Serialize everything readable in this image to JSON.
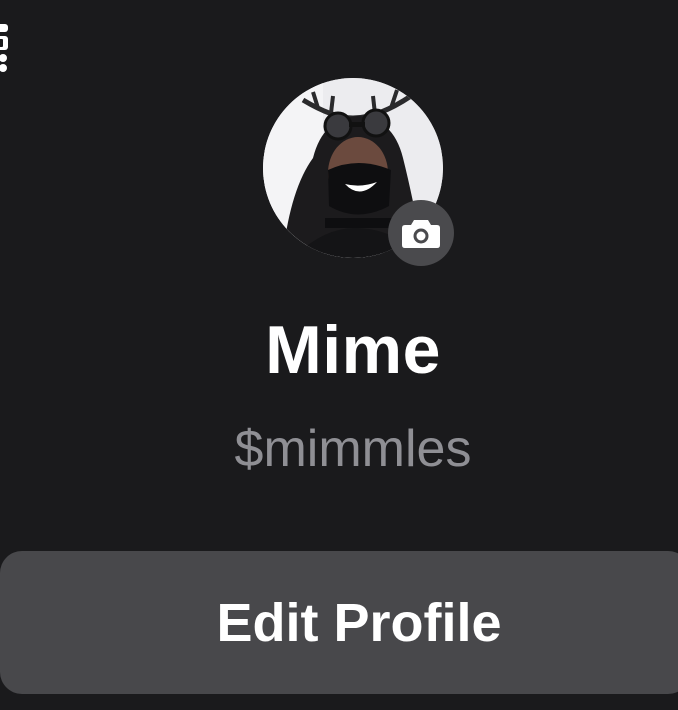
{
  "profile": {
    "display_name": "Mime",
    "cashtag": "$mimmles"
  },
  "actions": {
    "edit_profile_label": "Edit Profile"
  },
  "icons": {
    "top_left": "qr-code-icon",
    "avatar_badge": "camera-icon"
  },
  "colors": {
    "background": "#1a1a1c",
    "button": "#48484b",
    "badge": "#4a4a4d",
    "name_text": "#ffffff",
    "cashtag_text": "#8f8f94"
  }
}
